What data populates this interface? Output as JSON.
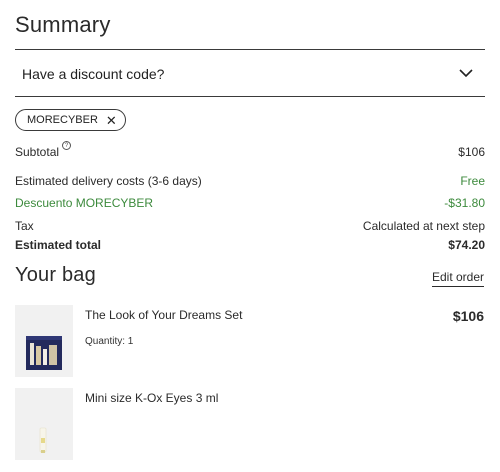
{
  "summary": {
    "title": "Summary",
    "discount_prompt": "Have a discount code?",
    "applied_code": "MORECYBER",
    "remove_glyph": "✕",
    "info_glyph": "?"
  },
  "totals": [
    {
      "label": "Subtotal",
      "value": "$106"
    },
    {
      "label": "Estimated delivery costs (3-6 days)",
      "value": "Free"
    },
    {
      "label": "Descuento MORECYBER",
      "value": "-$31.80"
    },
    {
      "label": "Tax",
      "value": "Calculated at next step"
    },
    {
      "label": "Estimated total",
      "value": "$74.20"
    }
  ],
  "bag": {
    "title": "Your bag",
    "edit_label": "Edit order",
    "items": [
      {
        "name": "The Look of Your Dreams Set",
        "quantity": "Quantity: 1",
        "price": "$106",
        "image": "product-set-box"
      },
      {
        "name": "Mini size K-Ox Eyes 3 ml",
        "image": "product-mini-tube"
      }
    ]
  },
  "colors": {
    "discount_green": "#3c8a3c",
    "thumb_bg": "#f1f1f1",
    "box_navy": "#232a5c"
  }
}
